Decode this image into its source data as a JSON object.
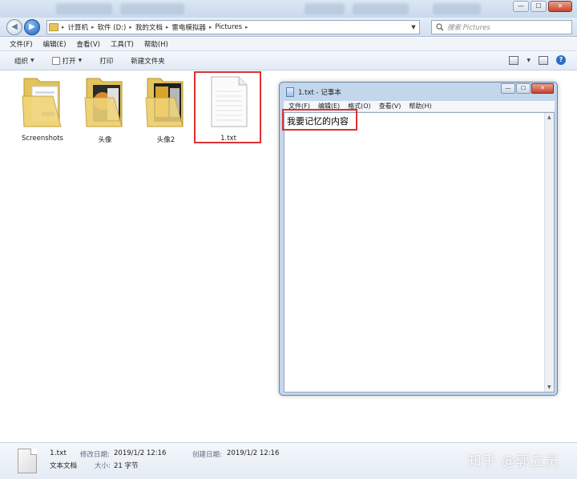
{
  "window": {
    "min": "—",
    "max": "☐",
    "close": "✕"
  },
  "address": {
    "crumbs": [
      "计算机",
      "软件 (D:)",
      "我的文档",
      "雷电模拟器",
      "Pictures"
    ],
    "search_placeholder": "搜索 Pictures"
  },
  "menu": [
    "文件(F)",
    "编辑(E)",
    "查看(V)",
    "工具(T)",
    "帮助(H)"
  ],
  "toolbar": {
    "organize": "组织",
    "open": "打开",
    "print": "打印",
    "new_folder": "新建文件夹"
  },
  "files": [
    {
      "name": "Screenshots",
      "kind": "folder"
    },
    {
      "name": "头像",
      "kind": "folder"
    },
    {
      "name": "头像2",
      "kind": "folder"
    },
    {
      "name": "1.txt",
      "kind": "text-file",
      "selected": true
    }
  ],
  "notepad": {
    "title": "1.txt - 记事本",
    "menu": [
      "文件(F)",
      "编辑(E)",
      "格式(O)",
      "查看(V)",
      "帮助(H)"
    ],
    "content": "我要记忆的内容"
  },
  "details": {
    "name": "1.txt",
    "type": "文本文档",
    "modified_label": "修改日期:",
    "modified_value": "2019/1/2 12:16",
    "created_label": "创建日期:",
    "created_value": "2019/1/2 12:16",
    "size_label": "大小:",
    "size_value": "21 字节"
  },
  "watermark": "知乎 @郭立员",
  "colors": {
    "highlight": "#d93232",
    "accent": "#1f64c0",
    "folder": "#e7c55a"
  },
  "icons": {
    "back": "back-arrow-icon",
    "forward": "forward-arrow-icon",
    "search": "search-icon",
    "folder": "folder-icon",
    "text_file": "text-file-icon",
    "notepad": "notepad-icon"
  }
}
